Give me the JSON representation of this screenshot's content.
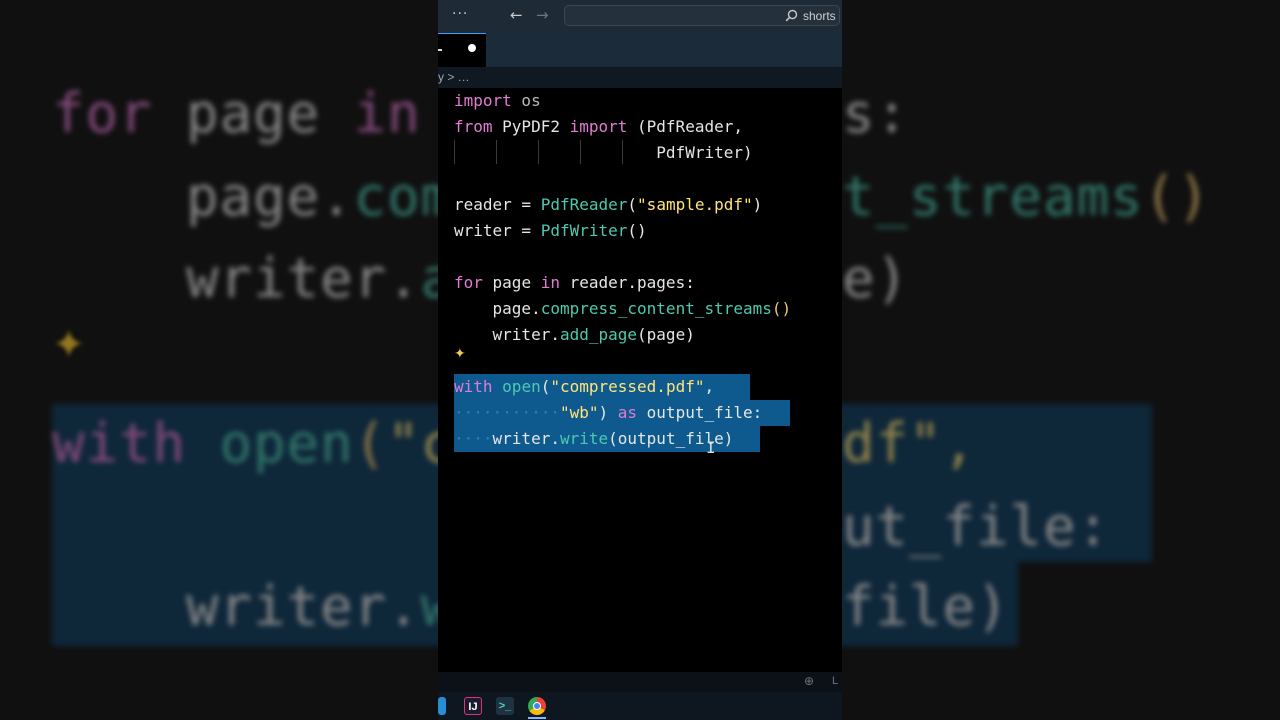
{
  "titlebar": {
    "menu_glyph": "···",
    "back_glyph": "←",
    "forward_glyph": "→",
    "search_text": "shorts"
  },
  "breadcrumb": {
    "text": "y > …"
  },
  "code_lines": [
    [
      {
        "t": "import",
        "c": "k"
      },
      {
        "t": " os",
        "c": "m"
      }
    ],
    [
      {
        "t": "from",
        "c": "k"
      },
      {
        "t": " PyPDF2 ",
        "c": "v"
      },
      {
        "t": "import",
        "c": "k"
      },
      {
        "t": " (PdfReader,",
        "c": "v"
      }
    ],
    [
      {
        "t": "                     PdfWriter)",
        "c": "v"
      }
    ],
    [],
    [
      {
        "t": "reader = ",
        "c": "v"
      },
      {
        "t": "PdfReader",
        "c": "f"
      },
      {
        "t": "(",
        "c": "v"
      },
      {
        "t": "\"sample.pdf\"",
        "c": "s"
      },
      {
        "t": ")",
        "c": "v"
      }
    ],
    [
      {
        "t": "writer = ",
        "c": "v"
      },
      {
        "t": "PdfWriter",
        "c": "f"
      },
      {
        "t": "()",
        "c": "v"
      }
    ],
    [],
    [
      {
        "t": "for",
        "c": "k"
      },
      {
        "t": " page ",
        "c": "v"
      },
      {
        "t": "in",
        "c": "k"
      },
      {
        "t": " reader.pages:",
        "c": "v"
      }
    ],
    [
      {
        "t": "    page.",
        "c": "v"
      },
      {
        "t": "compress_content_streams",
        "c": "f"
      },
      {
        "t": "()",
        "c": "p"
      }
    ],
    [
      {
        "t": "    writer.",
        "c": "v"
      },
      {
        "t": "add_page",
        "c": "f"
      },
      {
        "t": "(page)",
        "c": "v"
      }
    ],
    [],
    [
      {
        "t": "with",
        "c": "k"
      },
      {
        "t": " ",
        "c": "v"
      },
      {
        "t": "open",
        "c": "f"
      },
      {
        "t": "(",
        "c": "v"
      },
      {
        "t": "\"compressed.pdf\"",
        "c": "s"
      },
      {
        "t": ",",
        "c": "v"
      }
    ],
    [
      {
        "t": "···········",
        "c": "dots"
      },
      {
        "t": "\"wb\"",
        "c": "s"
      },
      {
        "t": ") ",
        "c": "v"
      },
      {
        "t": "as",
        "c": "k"
      },
      {
        "t": " output_file:",
        "c": "v"
      }
    ],
    [
      {
        "t": "····",
        "c": "dots"
      },
      {
        "t": "writer.",
        "c": "v"
      },
      {
        "t": "write",
        "c": "f"
      },
      {
        "t": "(output_file)",
        "c": "v"
      }
    ]
  ],
  "bg_lines": [
    [
      {
        "t": "for",
        "c": "k"
      },
      {
        "t": " page ",
        "c": "v"
      },
      {
        "t": "in",
        "c": "k"
      }
    ],
    [
      {
        "t": "    page.",
        "c": "v"
      },
      {
        "t": "com",
        "c": "f"
      }
    ],
    [
      {
        "t": "    writer.",
        "c": "v"
      },
      {
        "t": "a",
        "c": "f"
      }
    ],
    [
      {
        "t": "with",
        "c": "k"
      },
      {
        "t": " ",
        "c": "v"
      },
      {
        "t": "open",
        "c": "f"
      },
      {
        "t": "(",
        "c": "p"
      },
      {
        "t": "\"c",
        "c": "s"
      }
    ],
    [
      {
        "t": "    writer.",
        "c": "v"
      },
      {
        "t": "w",
        "c": "f"
      }
    ],
    [
      {
        "t": "s:",
        "c": "v"
      }
    ],
    [
      {
        "t": "t_streams",
        "c": "f"
      },
      {
        "t": "()",
        "c": "p"
      }
    ],
    [
      {
        "t": "e)",
        "c": "v"
      }
    ],
    [
      {
        "t": "df\",",
        "c": "s"
      }
    ],
    [
      {
        "t": "ut_file:",
        "c": "v"
      }
    ],
    [
      {
        "t": "file)",
        "c": "v"
      }
    ]
  ],
  "sparkle_glyph": "✦",
  "status": {
    "zoom_glyph": "⊕",
    "text": "L"
  },
  "taskbar": {
    "ij_label": "IJ",
    "terminal_label": ">_"
  },
  "colors": {
    "keyword": "#e27bd3",
    "function": "#4ec9b0",
    "string": "#ffe47a",
    "selection": "#0e5a8e",
    "accent": "#3fa0ff"
  }
}
